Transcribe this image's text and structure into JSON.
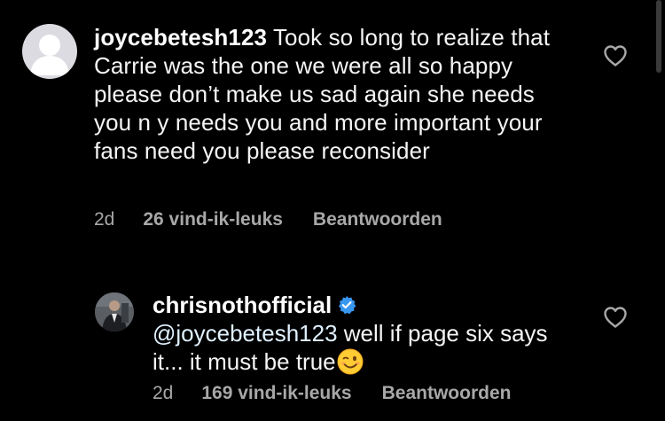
{
  "comments": [
    {
      "username": "joycebetesh123",
      "text": "Took so long to realize that Carrie was the one we were all so happy please don’t make us sad again she needs you n y needs you and more important your fans need you please reconsider",
      "time": "2d",
      "likes": "26 vind-ik-leuks",
      "reply_label": "Beantwoorden",
      "avatar": "default-avatar-icon",
      "like_icon": "heart-icon"
    },
    {
      "username": "chrisnothofficial",
      "verified": true,
      "mention": "@joycebetesh123",
      "text": "well if page six says it... it must be true",
      "emoji": "winking-face-emoji",
      "time": "2d",
      "likes": "169 vind-ik-leuks",
      "reply_label": "Beantwoorden",
      "avatar": "profile-photo",
      "like_icon": "heart-icon"
    }
  ],
  "colors": {
    "background": "#000000",
    "text": "#f5f5f5",
    "meta": "#a8a8a8",
    "verified": "#3897f0",
    "mention": "#e0f1ff"
  }
}
